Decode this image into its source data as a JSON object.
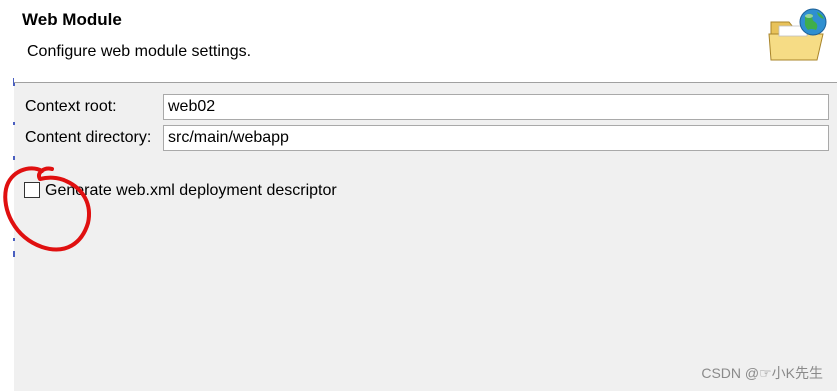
{
  "header": {
    "title": "Web Module",
    "subtitle": "Configure web module settings.",
    "banner_icon": "web-folder-globe-icon"
  },
  "form": {
    "context_root": {
      "label": "Context root:",
      "value": "web02"
    },
    "content_directory": {
      "label": "Content directory:",
      "value": "src/main/webapp"
    },
    "generate_descriptor": {
      "label": "Generate web.xml deployment descriptor",
      "checked": false
    }
  },
  "annotation": {
    "shape": "hand-drawn circle",
    "color": "#e01010"
  },
  "watermark": "CSDN @☞小K先生",
  "colors": {
    "header_bg": "#ffffff",
    "body_bg": "#f0f0f0",
    "annotation_red": "#e01010"
  }
}
